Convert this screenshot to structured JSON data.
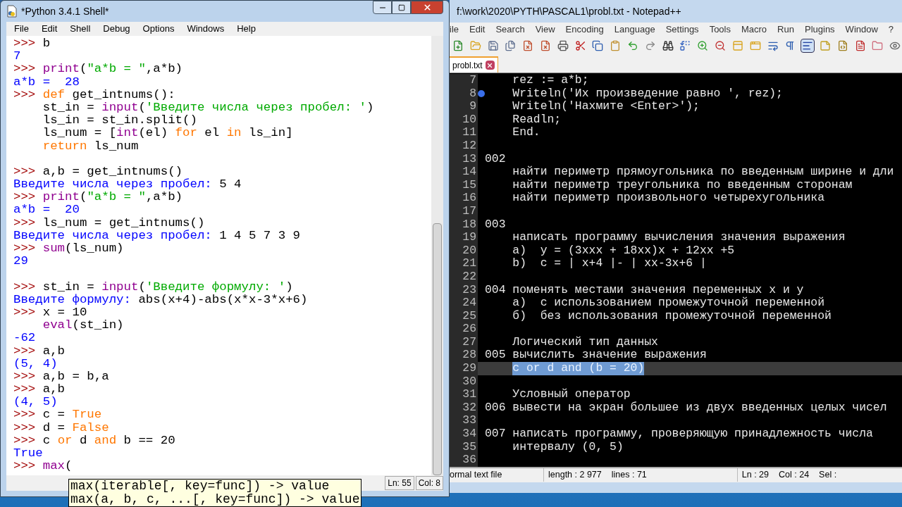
{
  "idle": {
    "title": "*Python 3.4.1 Shell*",
    "menu": [
      "File",
      "Edit",
      "Shell",
      "Debug",
      "Options",
      "Windows",
      "Help"
    ],
    "lines": [
      {
        "kind": "line",
        "segments": [
          {
            "kind": "prompt",
            "text": ">>> "
          },
          {
            "kind": "code",
            "text": "b"
          }
        ]
      },
      {
        "kind": "line",
        "segments": [
          {
            "kind": "output",
            "text": "7"
          }
        ]
      },
      {
        "kind": "line",
        "segments": [
          {
            "kind": "prompt",
            "text": ">>> "
          },
          {
            "kind": "builtin",
            "text": "print"
          },
          {
            "kind": "code",
            "text": "("
          },
          {
            "kind": "string",
            "text": "\"a*b = \""
          },
          {
            "kind": "code",
            "text": ",a*b)"
          }
        ]
      },
      {
        "kind": "line",
        "segments": [
          {
            "kind": "output",
            "text": "a*b =  28"
          }
        ]
      },
      {
        "kind": "line",
        "segments": [
          {
            "kind": "prompt",
            "text": ">>> "
          },
          {
            "kind": "keyword",
            "text": "def"
          },
          {
            "kind": "code",
            "text": " get_intnums():"
          }
        ]
      },
      {
        "kind": "line",
        "segments": [
          {
            "kind": "code",
            "text": "    st_in = "
          },
          {
            "kind": "builtin",
            "text": "input"
          },
          {
            "kind": "code",
            "text": "("
          },
          {
            "kind": "string",
            "text": "'Введите числа через пробел: '"
          },
          {
            "kind": "code",
            "text": ")"
          }
        ]
      },
      {
        "kind": "line",
        "segments": [
          {
            "kind": "code",
            "text": "    ls_in = st_in.split()"
          }
        ]
      },
      {
        "kind": "line",
        "segments": [
          {
            "kind": "code",
            "text": "    ls_num = ["
          },
          {
            "kind": "builtin",
            "text": "int"
          },
          {
            "kind": "code",
            "text": "(el) "
          },
          {
            "kind": "keyword",
            "text": "for"
          },
          {
            "kind": "code",
            "text": " el "
          },
          {
            "kind": "keyword",
            "text": "in"
          },
          {
            "kind": "code",
            "text": " ls_in]"
          }
        ]
      },
      {
        "kind": "line",
        "segments": [
          {
            "kind": "keyword",
            "text": "    return"
          },
          {
            "kind": "code",
            "text": " ls_num"
          }
        ]
      },
      {
        "kind": "blank"
      },
      {
        "kind": "line",
        "segments": [
          {
            "kind": "prompt",
            "text": ">>> "
          },
          {
            "kind": "code",
            "text": "a,b = get_intnums()"
          }
        ]
      },
      {
        "kind": "line",
        "segments": [
          {
            "kind": "output",
            "text": "Введите числа через пробел: "
          },
          {
            "kind": "code",
            "text": "5 4"
          }
        ]
      },
      {
        "kind": "line",
        "segments": [
          {
            "kind": "prompt",
            "text": ">>> "
          },
          {
            "kind": "builtin",
            "text": "print"
          },
          {
            "kind": "code",
            "text": "("
          },
          {
            "kind": "string",
            "text": "\"a*b = \""
          },
          {
            "kind": "code",
            "text": ",a*b)"
          }
        ]
      },
      {
        "kind": "line",
        "segments": [
          {
            "kind": "output",
            "text": "a*b =  20"
          }
        ]
      },
      {
        "kind": "line",
        "segments": [
          {
            "kind": "prompt",
            "text": ">>> "
          },
          {
            "kind": "code",
            "text": "ls_num = get_intnums()"
          }
        ]
      },
      {
        "kind": "line",
        "segments": [
          {
            "kind": "output",
            "text": "Введите числа через пробел: "
          },
          {
            "kind": "code",
            "text": "1 4 5 7 3 9"
          }
        ]
      },
      {
        "kind": "line",
        "segments": [
          {
            "kind": "prompt",
            "text": ">>> "
          },
          {
            "kind": "builtin",
            "text": "sum"
          },
          {
            "kind": "code",
            "text": "(ls_num)"
          }
        ]
      },
      {
        "kind": "line",
        "segments": [
          {
            "kind": "output",
            "text": "29"
          }
        ]
      },
      {
        "kind": "blank"
      },
      {
        "kind": "line",
        "segments": [
          {
            "kind": "prompt",
            "text": ">>> "
          },
          {
            "kind": "code",
            "text": "st_in = "
          },
          {
            "kind": "builtin",
            "text": "input"
          },
          {
            "kind": "code",
            "text": "("
          },
          {
            "kind": "string",
            "text": "'Введите формулу: '"
          },
          {
            "kind": "code",
            "text": ")"
          }
        ]
      },
      {
        "kind": "line",
        "segments": [
          {
            "kind": "output",
            "text": "Введите формулу: "
          },
          {
            "kind": "code",
            "text": "abs(x+4)-abs(x*x-3*x+6)"
          }
        ]
      },
      {
        "kind": "line",
        "segments": [
          {
            "kind": "prompt",
            "text": ">>> "
          },
          {
            "kind": "code",
            "text": "x = 10"
          }
        ]
      },
      {
        "kind": "line",
        "segments": [
          {
            "kind": "builtin",
            "text": "    eval"
          },
          {
            "kind": "code",
            "text": "(st_in)"
          }
        ]
      },
      {
        "kind": "line",
        "segments": [
          {
            "kind": "output",
            "text": "-62"
          }
        ]
      },
      {
        "kind": "line",
        "segments": [
          {
            "kind": "prompt",
            "text": ">>> "
          },
          {
            "kind": "code",
            "text": "a,b"
          }
        ]
      },
      {
        "kind": "line",
        "segments": [
          {
            "kind": "output",
            "text": "(5, 4)"
          }
        ]
      },
      {
        "kind": "line",
        "segments": [
          {
            "kind": "prompt",
            "text": ">>> "
          },
          {
            "kind": "code",
            "text": "a,b = b,a"
          }
        ]
      },
      {
        "kind": "line",
        "segments": [
          {
            "kind": "prompt",
            "text": ">>> "
          },
          {
            "kind": "code",
            "text": "a,b"
          }
        ]
      },
      {
        "kind": "line",
        "segments": [
          {
            "kind": "output",
            "text": "(4, 5)"
          }
        ]
      },
      {
        "kind": "line",
        "segments": [
          {
            "kind": "prompt",
            "text": ">>> "
          },
          {
            "kind": "code",
            "text": "c = "
          },
          {
            "kind": "keyword",
            "text": "True"
          }
        ]
      },
      {
        "kind": "line",
        "segments": [
          {
            "kind": "prompt",
            "text": ">>> "
          },
          {
            "kind": "code",
            "text": "d = "
          },
          {
            "kind": "keyword",
            "text": "False"
          }
        ]
      },
      {
        "kind": "line",
        "segments": [
          {
            "kind": "prompt",
            "text": ">>> "
          },
          {
            "kind": "code",
            "text": "c "
          },
          {
            "kind": "keyword",
            "text": "or"
          },
          {
            "kind": "code",
            "text": " d "
          },
          {
            "kind": "keyword",
            "text": "and"
          },
          {
            "kind": "code",
            "text": " b == 20"
          }
        ]
      },
      {
        "kind": "line",
        "segments": [
          {
            "kind": "output",
            "text": "True"
          }
        ]
      },
      {
        "kind": "line",
        "segments": [
          {
            "kind": "prompt",
            "text": ">>> "
          },
          {
            "kind": "builtin",
            "text": "max"
          },
          {
            "kind": "code",
            "text": "("
          }
        ]
      }
    ],
    "calltip": [
      "max(iterable[, key=func]) -> value",
      "max(a, b, c, ...[, key=func]) -> value"
    ],
    "status": [
      "Ln: 55",
      "Col: 8"
    ]
  },
  "notepad": {
    "title": "f:\\work\\2020\\PYTH\\PASCAL1\\probl.txt - Notepad++",
    "menu": [
      "ile",
      "Edit",
      "Search",
      "View",
      "Encoding",
      "Language",
      "Settings",
      "Tools",
      "Macro",
      "Run",
      "Plugins",
      "Window",
      "?"
    ],
    "tabs": [
      {
        "label": "probl.txt",
        "selected": true
      }
    ],
    "lines": [
      {
        "number": "7",
        "text": "    rez := a*b;",
        "bookmark": false,
        "current": false
      },
      {
        "number": "8",
        "text": "    Writeln('Их произведение равно ', rez);",
        "bookmark": true,
        "current": false
      },
      {
        "number": "9",
        "text": "    Writeln('Нахмите <Enter>');",
        "bookmark": false,
        "current": false
      },
      {
        "number": "10",
        "text": "    Readln;",
        "bookmark": false,
        "current": false
      },
      {
        "number": "11",
        "text": "    End.",
        "bookmark": false,
        "current": false
      },
      {
        "number": "12",
        "bookmark": false,
        "current": false
      },
      {
        "number": "13",
        "text": "002",
        "bookmark": false,
        "current": false
      },
      {
        "number": "14",
        "text": "    найти периметр прямоугольника по введенным ширине и дли",
        "bookmark": false,
        "current": false
      },
      {
        "number": "15",
        "text": "    найти периметр треугольника по введенным сторонам",
        "bookmark": false,
        "current": false
      },
      {
        "number": "16",
        "text": "    найти периметр произвольного четырехугольника",
        "bookmark": false,
        "current": false
      },
      {
        "number": "17",
        "bookmark": false,
        "current": false
      },
      {
        "number": "18",
        "text": "003",
        "bookmark": false,
        "current": false
      },
      {
        "number": "19",
        "text": "    написать программу вычисления значения выражения",
        "bookmark": false,
        "current": false
      },
      {
        "number": "20",
        "text": "    а)  y = (3xxx + 18xx)x + 12xx +5",
        "bookmark": false,
        "current": false
      },
      {
        "number": "21",
        "text": "    b)  c = | x+4 |- | xx-3x+6 |",
        "bookmark": false,
        "current": false
      },
      {
        "number": "22",
        "bookmark": false,
        "current": false
      },
      {
        "number": "23",
        "text": "004 поменять местами значения переменных x и y",
        "bookmark": false,
        "current": false
      },
      {
        "number": "24",
        "text": "    а)  с использованием промежуточной переменной",
        "bookmark": false,
        "current": false
      },
      {
        "number": "25",
        "text": "    б)  без использования промежуточной переменной",
        "bookmark": false,
        "current": false
      },
      {
        "number": "26",
        "bookmark": false,
        "current": false
      },
      {
        "number": "27",
        "text": "    Логический тип данных",
        "bookmark": false,
        "current": false
      },
      {
        "number": "28",
        "text": "005 вычислить значение выражения",
        "bookmark": false,
        "current": false
      },
      {
        "number": "29",
        "text": "    c or d and (b = 20)",
        "bookmark": false,
        "current": true
      },
      {
        "number": "30",
        "bookmark": false,
        "current": false
      },
      {
        "number": "31",
        "text": "    Условный оператор",
        "bookmark": false,
        "current": false
      },
      {
        "number": "32",
        "text": "006 вывести на экран большее из двух введенных целых чисел",
        "bookmark": false,
        "current": false
      },
      {
        "number": "33",
        "bookmark": false,
        "current": false
      },
      {
        "number": "34",
        "text": "007 написать программу, проверяющую принадлежность числа",
        "bookmark": false,
        "current": false
      },
      {
        "number": "35",
        "text": "    интервалу (0, 5)",
        "bookmark": false,
        "current": false
      },
      {
        "number": "36",
        "bookmark": false,
        "current": false
      }
    ],
    "status": [
      "ormal text file",
      "length : 2 977",
      "lines : 71",
      "Ln : 29",
      "Col : 24",
      "Sel :"
    ]
  }
}
